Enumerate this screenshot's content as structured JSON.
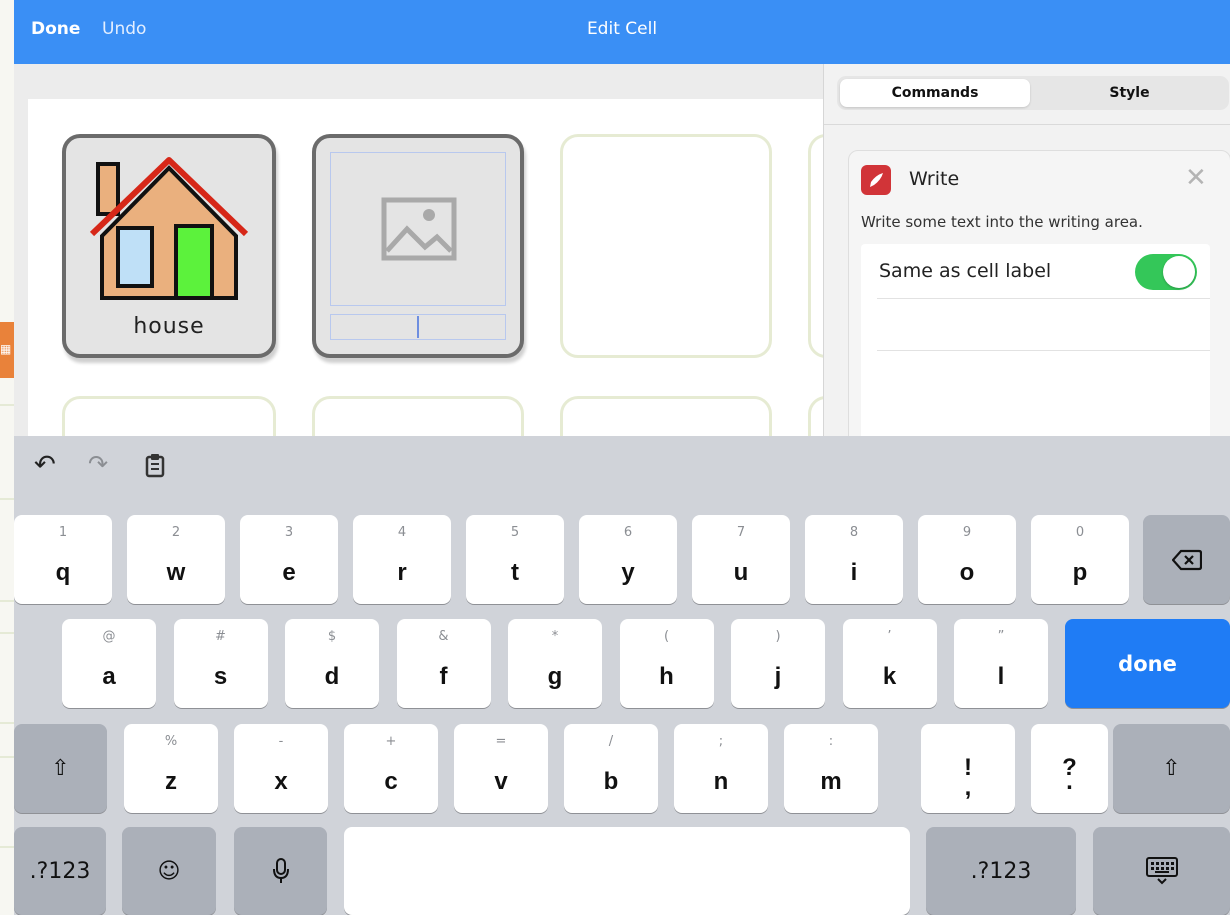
{
  "nav": {
    "done": "Done",
    "undo": "Undo",
    "title": "Edit Cell"
  },
  "grid": {
    "cell_label": "house"
  },
  "inspector": {
    "tabs": {
      "commands": "Commands",
      "style": "Style"
    },
    "command": {
      "title": "Write",
      "description": "Write some text into the writing area.",
      "option_label": "Same as cell label",
      "option_enabled": true
    }
  },
  "keyboard": {
    "row1": [
      {
        "sec": "1",
        "key": "q"
      },
      {
        "sec": "2",
        "key": "w"
      },
      {
        "sec": "3",
        "key": "e"
      },
      {
        "sec": "4",
        "key": "r"
      },
      {
        "sec": "5",
        "key": "t"
      },
      {
        "sec": "6",
        "key": "y"
      },
      {
        "sec": "7",
        "key": "u"
      },
      {
        "sec": "8",
        "key": "i"
      },
      {
        "sec": "9",
        "key": "o"
      },
      {
        "sec": "0",
        "key": "p"
      }
    ],
    "row2": [
      {
        "sec": "@",
        "key": "a"
      },
      {
        "sec": "#",
        "key": "s"
      },
      {
        "sec": "$",
        "key": "d"
      },
      {
        "sec": "&",
        "key": "f"
      },
      {
        "sec": "*",
        "key": "g"
      },
      {
        "sec": "(",
        "key": "h"
      },
      {
        "sec": ")",
        "key": "j"
      },
      {
        "sec": "’",
        "key": "k"
      },
      {
        "sec": "”",
        "key": "l"
      }
    ],
    "row3": [
      {
        "sec": "%",
        "key": "z"
      },
      {
        "sec": "-",
        "key": "x"
      },
      {
        "sec": "+",
        "key": "c"
      },
      {
        "sec": "=",
        "key": "v"
      },
      {
        "sec": "/",
        "key": "b"
      },
      {
        "sec": ";",
        "key": "n"
      },
      {
        "sec": ":",
        "key": "m"
      }
    ],
    "punct1": {
      "top": "!",
      "bottom": ","
    },
    "punct2": {
      "top": "?",
      "bottom": "."
    },
    "done": "done",
    "numbers": ".?123",
    "icons": {
      "undo": "undo-icon",
      "redo": "redo-icon",
      "paste": "paste-icon",
      "backspace": "backspace-icon",
      "shift": "shift-icon",
      "emoji": "emoji-icon",
      "mic": "microphone-icon",
      "dismiss": "keyboard-dismiss-icon"
    }
  }
}
